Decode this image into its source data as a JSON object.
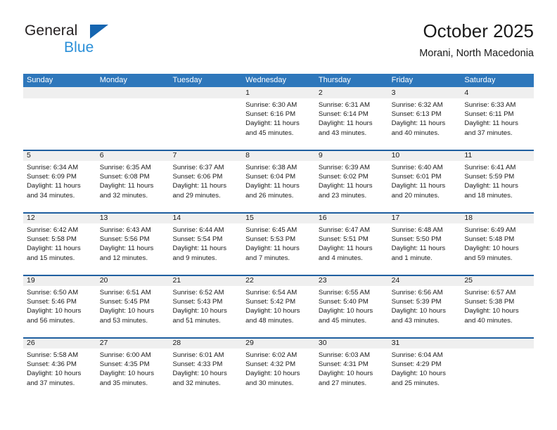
{
  "brand": {
    "name_primary": "General",
    "name_secondary": "Blue",
    "triangle_icon": "triangle-icon",
    "accent_blue": "#1565b0",
    "light_blue": "#2a8fd8"
  },
  "header": {
    "title": "October 2025",
    "subtitle": "Morani, North Macedonia"
  },
  "colors": {
    "header_bar": "#2e77bb",
    "week_separator": "#1f5fa0",
    "date_band": "#efefef",
    "text": "#1a1a1a"
  },
  "calendar": {
    "day_headers": [
      "Sunday",
      "Monday",
      "Tuesday",
      "Wednesday",
      "Thursday",
      "Friday",
      "Saturday"
    ],
    "weeks": [
      {
        "days": [
          {
            "date": "",
            "sunrise": "",
            "sunset": "",
            "daylight_line1": "",
            "daylight_line2": ""
          },
          {
            "date": "",
            "sunrise": "",
            "sunset": "",
            "daylight_line1": "",
            "daylight_line2": ""
          },
          {
            "date": "",
            "sunrise": "",
            "sunset": "",
            "daylight_line1": "",
            "daylight_line2": ""
          },
          {
            "date": "1",
            "sunrise": "Sunrise: 6:30 AM",
            "sunset": "Sunset: 6:16 PM",
            "daylight_line1": "Daylight: 11 hours",
            "daylight_line2": "and 45 minutes."
          },
          {
            "date": "2",
            "sunrise": "Sunrise: 6:31 AM",
            "sunset": "Sunset: 6:14 PM",
            "daylight_line1": "Daylight: 11 hours",
            "daylight_line2": "and 43 minutes."
          },
          {
            "date": "3",
            "sunrise": "Sunrise: 6:32 AM",
            "sunset": "Sunset: 6:13 PM",
            "daylight_line1": "Daylight: 11 hours",
            "daylight_line2": "and 40 minutes."
          },
          {
            "date": "4",
            "sunrise": "Sunrise: 6:33 AM",
            "sunset": "Sunset: 6:11 PM",
            "daylight_line1": "Daylight: 11 hours",
            "daylight_line2": "and 37 minutes."
          }
        ]
      },
      {
        "days": [
          {
            "date": "5",
            "sunrise": "Sunrise: 6:34 AM",
            "sunset": "Sunset: 6:09 PM",
            "daylight_line1": "Daylight: 11 hours",
            "daylight_line2": "and 34 minutes."
          },
          {
            "date": "6",
            "sunrise": "Sunrise: 6:35 AM",
            "sunset": "Sunset: 6:08 PM",
            "daylight_line1": "Daylight: 11 hours",
            "daylight_line2": "and 32 minutes."
          },
          {
            "date": "7",
            "sunrise": "Sunrise: 6:37 AM",
            "sunset": "Sunset: 6:06 PM",
            "daylight_line1": "Daylight: 11 hours",
            "daylight_line2": "and 29 minutes."
          },
          {
            "date": "8",
            "sunrise": "Sunrise: 6:38 AM",
            "sunset": "Sunset: 6:04 PM",
            "daylight_line1": "Daylight: 11 hours",
            "daylight_line2": "and 26 minutes."
          },
          {
            "date": "9",
            "sunrise": "Sunrise: 6:39 AM",
            "sunset": "Sunset: 6:02 PM",
            "daylight_line1": "Daylight: 11 hours",
            "daylight_line2": "and 23 minutes."
          },
          {
            "date": "10",
            "sunrise": "Sunrise: 6:40 AM",
            "sunset": "Sunset: 6:01 PM",
            "daylight_line1": "Daylight: 11 hours",
            "daylight_line2": "and 20 minutes."
          },
          {
            "date": "11",
            "sunrise": "Sunrise: 6:41 AM",
            "sunset": "Sunset: 5:59 PM",
            "daylight_line1": "Daylight: 11 hours",
            "daylight_line2": "and 18 minutes."
          }
        ]
      },
      {
        "days": [
          {
            "date": "12",
            "sunrise": "Sunrise: 6:42 AM",
            "sunset": "Sunset: 5:58 PM",
            "daylight_line1": "Daylight: 11 hours",
            "daylight_line2": "and 15 minutes."
          },
          {
            "date": "13",
            "sunrise": "Sunrise: 6:43 AM",
            "sunset": "Sunset: 5:56 PM",
            "daylight_line1": "Daylight: 11 hours",
            "daylight_line2": "and 12 minutes."
          },
          {
            "date": "14",
            "sunrise": "Sunrise: 6:44 AM",
            "sunset": "Sunset: 5:54 PM",
            "daylight_line1": "Daylight: 11 hours",
            "daylight_line2": "and 9 minutes."
          },
          {
            "date": "15",
            "sunrise": "Sunrise: 6:45 AM",
            "sunset": "Sunset: 5:53 PM",
            "daylight_line1": "Daylight: 11 hours",
            "daylight_line2": "and 7 minutes."
          },
          {
            "date": "16",
            "sunrise": "Sunrise: 6:47 AM",
            "sunset": "Sunset: 5:51 PM",
            "daylight_line1": "Daylight: 11 hours",
            "daylight_line2": "and 4 minutes."
          },
          {
            "date": "17",
            "sunrise": "Sunrise: 6:48 AM",
            "sunset": "Sunset: 5:50 PM",
            "daylight_line1": "Daylight: 11 hours",
            "daylight_line2": "and 1 minute."
          },
          {
            "date": "18",
            "sunrise": "Sunrise: 6:49 AM",
            "sunset": "Sunset: 5:48 PM",
            "daylight_line1": "Daylight: 10 hours",
            "daylight_line2": "and 59 minutes."
          }
        ]
      },
      {
        "days": [
          {
            "date": "19",
            "sunrise": "Sunrise: 6:50 AM",
            "sunset": "Sunset: 5:46 PM",
            "daylight_line1": "Daylight: 10 hours",
            "daylight_line2": "and 56 minutes."
          },
          {
            "date": "20",
            "sunrise": "Sunrise: 6:51 AM",
            "sunset": "Sunset: 5:45 PM",
            "daylight_line1": "Daylight: 10 hours",
            "daylight_line2": "and 53 minutes."
          },
          {
            "date": "21",
            "sunrise": "Sunrise: 6:52 AM",
            "sunset": "Sunset: 5:43 PM",
            "daylight_line1": "Daylight: 10 hours",
            "daylight_line2": "and 51 minutes."
          },
          {
            "date": "22",
            "sunrise": "Sunrise: 6:54 AM",
            "sunset": "Sunset: 5:42 PM",
            "daylight_line1": "Daylight: 10 hours",
            "daylight_line2": "and 48 minutes."
          },
          {
            "date": "23",
            "sunrise": "Sunrise: 6:55 AM",
            "sunset": "Sunset: 5:40 PM",
            "daylight_line1": "Daylight: 10 hours",
            "daylight_line2": "and 45 minutes."
          },
          {
            "date": "24",
            "sunrise": "Sunrise: 6:56 AM",
            "sunset": "Sunset: 5:39 PM",
            "daylight_line1": "Daylight: 10 hours",
            "daylight_line2": "and 43 minutes."
          },
          {
            "date": "25",
            "sunrise": "Sunrise: 6:57 AM",
            "sunset": "Sunset: 5:38 PM",
            "daylight_line1": "Daylight: 10 hours",
            "daylight_line2": "and 40 minutes."
          }
        ]
      },
      {
        "days": [
          {
            "date": "26",
            "sunrise": "Sunrise: 5:58 AM",
            "sunset": "Sunset: 4:36 PM",
            "daylight_line1": "Daylight: 10 hours",
            "daylight_line2": "and 37 minutes."
          },
          {
            "date": "27",
            "sunrise": "Sunrise: 6:00 AM",
            "sunset": "Sunset: 4:35 PM",
            "daylight_line1": "Daylight: 10 hours",
            "daylight_line2": "and 35 minutes."
          },
          {
            "date": "28",
            "sunrise": "Sunrise: 6:01 AM",
            "sunset": "Sunset: 4:33 PM",
            "daylight_line1": "Daylight: 10 hours",
            "daylight_line2": "and 32 minutes."
          },
          {
            "date": "29",
            "sunrise": "Sunrise: 6:02 AM",
            "sunset": "Sunset: 4:32 PM",
            "daylight_line1": "Daylight: 10 hours",
            "daylight_line2": "and 30 minutes."
          },
          {
            "date": "30",
            "sunrise": "Sunrise: 6:03 AM",
            "sunset": "Sunset: 4:31 PM",
            "daylight_line1": "Daylight: 10 hours",
            "daylight_line2": "and 27 minutes."
          },
          {
            "date": "31",
            "sunrise": "Sunrise: 6:04 AM",
            "sunset": "Sunset: 4:29 PM",
            "daylight_line1": "Daylight: 10 hours",
            "daylight_line2": "and 25 minutes."
          },
          {
            "date": "",
            "sunrise": "",
            "sunset": "",
            "daylight_line1": "",
            "daylight_line2": ""
          }
        ]
      }
    ]
  }
}
